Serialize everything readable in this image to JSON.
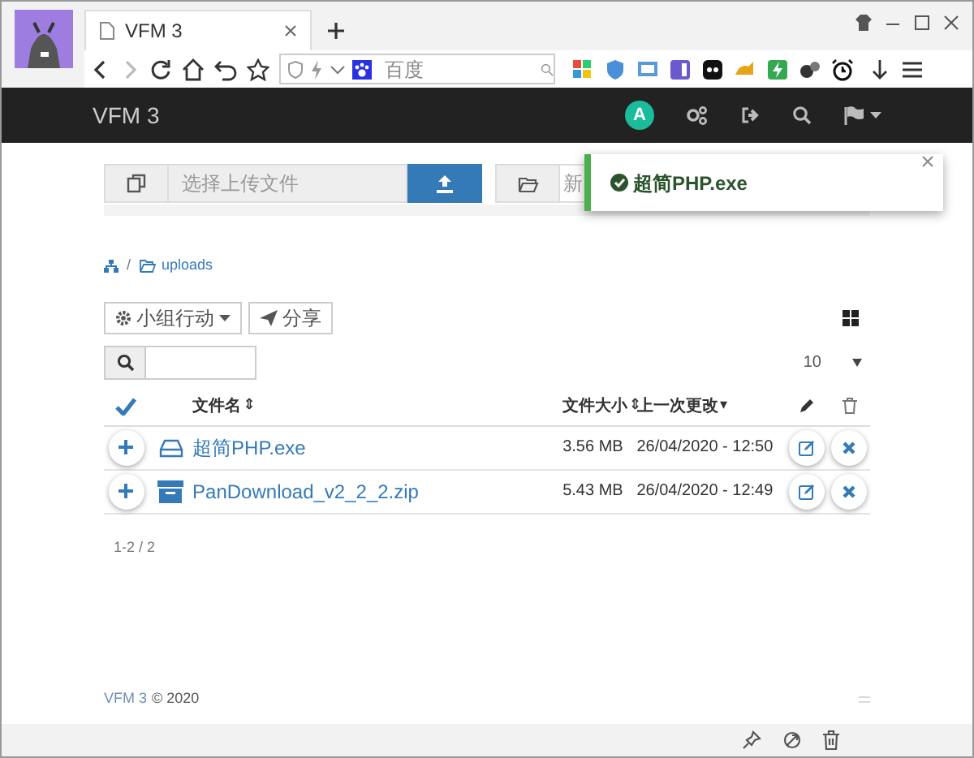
{
  "browser": {
    "tabs": [
      {
        "title": "VFM 3",
        "selected": true
      }
    ],
    "address": {
      "placeholder": "百度"
    }
  },
  "navbar": {
    "brand": "VFM 3",
    "user_initial": "A"
  },
  "upload": {
    "file_placeholder": "选择上传文件",
    "folder_placeholder": "新"
  },
  "toast": {
    "kind": "success",
    "message": "超简PHP.exe"
  },
  "breadcrumb": {
    "separator": "/",
    "folder": "uploads"
  },
  "actions": {
    "group_button": "小组行动",
    "share_button": "分享"
  },
  "list": {
    "page_size": "10",
    "columns": [
      {
        "label": "文件名",
        "sort": "⇕"
      },
      {
        "label": "文件大小",
        "sort": "⇕"
      },
      {
        "label": "上一次更改",
        "sort": "▾"
      }
    ],
    "rows": [
      {
        "kind": "drive",
        "name": "超简PHP.exe",
        "size": "3.56 MB",
        "date": "26/04/2020 - 12:50"
      },
      {
        "kind": "archive",
        "name": "PanDownload_v2_2_2.zip",
        "size": "5.43 MB",
        "date": "26/04/2020 - 12:49"
      }
    ],
    "count": "1-2 / 2"
  },
  "footer": {
    "link": "VFM 3",
    "text": "© 2020"
  }
}
